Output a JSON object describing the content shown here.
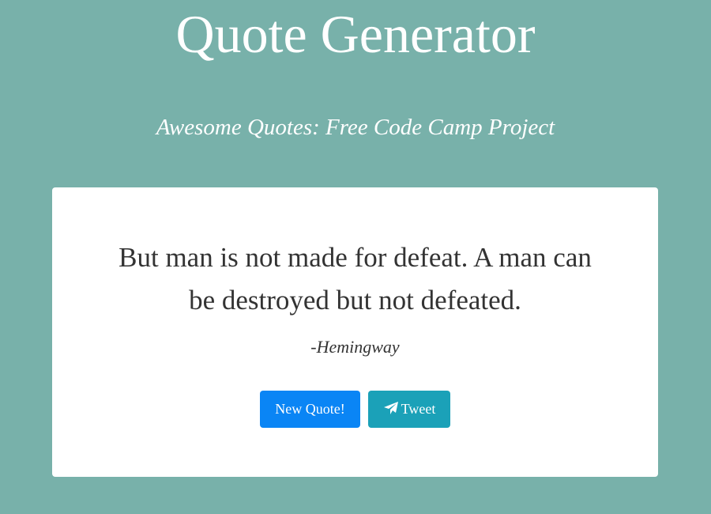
{
  "header": {
    "title": "Quote Generator",
    "subtitle": "Awesome Quotes: Free Code Camp Project"
  },
  "quote": {
    "text": "But man is not made for defeat. A man can be destroyed but not defeated.",
    "author": "-Hemingway"
  },
  "buttons": {
    "new_quote_label": "New Quote!",
    "tweet_label": "Tweet",
    "tweet_icon": "paper-plane-icon"
  },
  "colors": {
    "background": "#78b1aa",
    "card": "#ffffff",
    "new_quote_button": "#0a85f5",
    "tweet_button": "#1ba1b8",
    "text": "#333333"
  }
}
